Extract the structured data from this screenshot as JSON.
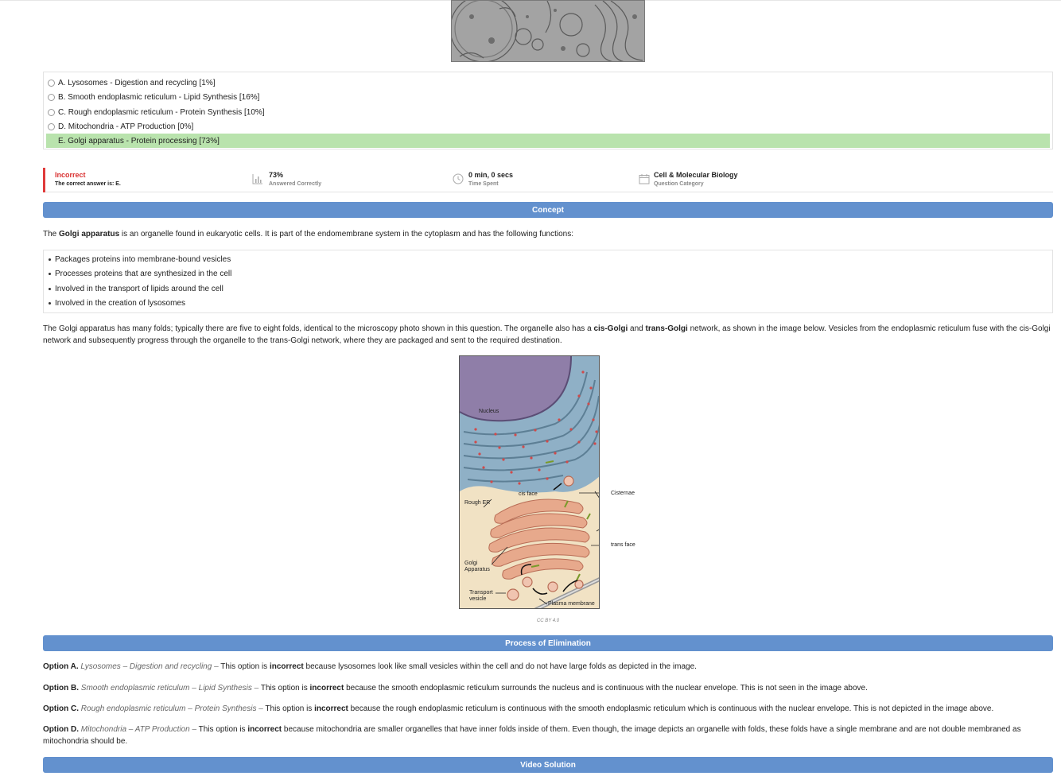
{
  "options": [
    {
      "label": "A. Lysosomes - Digestion and recycling [1%]",
      "correct": false
    },
    {
      "label": "B. Smooth endoplasmic reticulum - Lipid Synthesis [16%]",
      "correct": false
    },
    {
      "label": "C. Rough endoplasmic reticulum - Protein Synthesis [10%]",
      "correct": false
    },
    {
      "label": "D. Mitochondria - ATP Production [0%]",
      "correct": false
    },
    {
      "label": "E. Golgi apparatus - Protein processing [73%]",
      "correct": true
    }
  ],
  "status": {
    "result": "Incorrect",
    "correct_answer": "The correct answer is: E.",
    "percent": "73%",
    "percent_label": "Answered Correctly",
    "time": "0 min, 0 secs",
    "time_label": "Time Spent",
    "category": "Cell & Molecular Biology",
    "category_label": "Question Category",
    "accent_color": "#e03a3a"
  },
  "sections": {
    "concept": "Concept",
    "elimination": "Process of Elimination",
    "video": "Video Solution",
    "header_color": "#6391ce"
  },
  "concept": {
    "intro_pre": "The ",
    "intro_bold": "Golgi apparatus",
    "intro_post": " is an organelle found in eukaryotic cells. It is part of the endomembrane system in the cytoplasm and has the following functions:",
    "bullets": [
      "Packages proteins into membrane-bound vesicles",
      "Processes proteins that are synthesized in the cell",
      "Involved in the transport of lipids around the cell",
      "Involved in the creation of lysosomes"
    ],
    "para2_a": "The Golgi apparatus has many folds; typically there are five to eight folds, identical to the microscopy photo shown in this question. The organelle also has a ",
    "para2_b": "cis-Golgi",
    "para2_c": " and ",
    "para2_d": "trans-Golgi",
    "para2_e": " network, as shown in the image below. Vesicles from the endoplasmic reticulum fuse with the cis-Golgi network and subsequently progress through the organelle to the trans-Golgi network, where they are packaged and sent to the required destination."
  },
  "diagram": {
    "nucleus": "Nucleus",
    "cis_face": "cis face",
    "rough_er": "Rough ER",
    "cisternae": "Cisternae",
    "trans_face": "trans face",
    "golgi": "Golgi Apparatus",
    "transport": "Transport vesicle",
    "plasma": "Plasma membrane",
    "credit": "CC BY 4.0"
  },
  "elimination": [
    {
      "label": "Option A.",
      "italic": "Lysosomes – Digestion and recycling –",
      "pre": " This option is ",
      "bold": "incorrect",
      "post": " because lysosomes look like small vesicles within the cell and do not have large folds as depicted in the image."
    },
    {
      "label": "Option B.",
      "italic": "Smooth endoplasmic reticulum – Lipid Synthesis –",
      "pre": " This option is ",
      "bold": "incorrect",
      "post": " because the smooth endoplasmic reticulum surrounds the nucleus and is continuous with the nuclear envelope. This is not seen in the image above."
    },
    {
      "label": "Option C.",
      "italic": "Rough endoplasmic reticulum – Protein Synthesis –",
      "pre": " This option is ",
      "bold": "incorrect",
      "post": " because the rough endoplasmic reticulum is continuous with the smooth endoplasmic reticulum which is continuous with the nuclear envelope. This is not depicted in the image above."
    },
    {
      "label": "Option D.",
      "italic": "Mitochondria – ATP Production –",
      "pre": " This option is ",
      "bold": "incorrect",
      "post": " because mitochondria are smaller organelles that have inner folds inside of them. Even though, the image depicts an organelle with folds, these folds have a single membrane and are not double membraned as mitochondria should be."
    }
  ]
}
